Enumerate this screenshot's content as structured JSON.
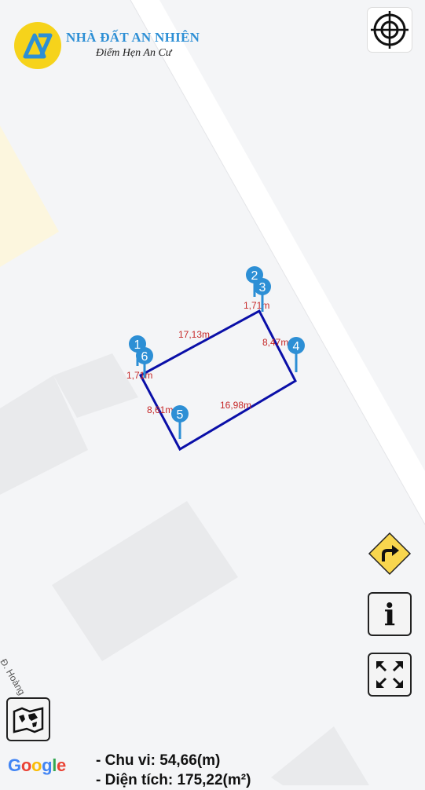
{
  "brand": {
    "name": "NHÀ ĐẤT AN NHIÊN",
    "tagline": "Điểm Hẹn An Cư",
    "colors": {
      "circle": "#f6d31b",
      "title": "#2d8fd5"
    }
  },
  "map": {
    "street_label": "Đ. Hoàng",
    "colors": {
      "background": "#f4f5f7",
      "road": "#ffffff",
      "building": "#e9eaec",
      "park": "#fcf6de",
      "polygon": "#0a0fa8",
      "measure_text": "#c62828",
      "pin": "#2d8fd5"
    },
    "pins": [
      {
        "label": "1"
      },
      {
        "label": "2"
      },
      {
        "label": "3"
      },
      {
        "label": "4"
      },
      {
        "label": "5"
      },
      {
        "label": "6"
      }
    ],
    "edge_labels": [
      "17,13m",
      "8,47m",
      "16,98m",
      "8,61m",
      "1,71m",
      "1,71m"
    ]
  },
  "controls": {
    "locate_icon": "crosshair-icon",
    "directions_icon": "turn-right-arrow-icon",
    "info_label": "i",
    "info_icon": "info-icon",
    "fullscreen_icon": "fullscreen-icon",
    "layers_icon": "map-layers-icon"
  },
  "attribution": {
    "google": [
      "G",
      "o",
      "o",
      "g",
      "l",
      "e"
    ]
  },
  "summary": {
    "perimeter": "- Chu vi: 54,66(m)",
    "area": "- Diện tích: 175,22(m²)"
  }
}
